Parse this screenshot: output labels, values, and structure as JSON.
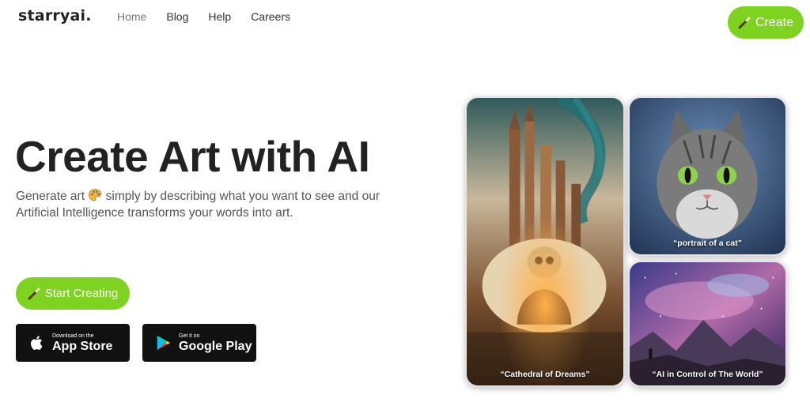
{
  "brand": {
    "logo": "starryai."
  },
  "nav": {
    "links": [
      "Home",
      "Blog",
      "Help",
      "Careers"
    ],
    "create_label": "Create"
  },
  "hero": {
    "title": "Create Art with AI",
    "subtitle_part1": "Generate art",
    "subtitle_part2": "simply by describing what you want to see and our Artificial Intelligence transforms your words into art.",
    "start_label": "Start Creating"
  },
  "stores": {
    "apple": {
      "small": "Download on the",
      "big": "App Store"
    },
    "google": {
      "small": "Get it on",
      "big": "Google Play"
    }
  },
  "gallery": {
    "cathedral_caption": "“Cathedral of Dreams”",
    "cat_caption": "“portrait of a cat”",
    "space_caption": "“AI in Control of The World”"
  },
  "colors": {
    "accent": "#7ed321",
    "text": "#222222",
    "store_bg": "#111111"
  }
}
